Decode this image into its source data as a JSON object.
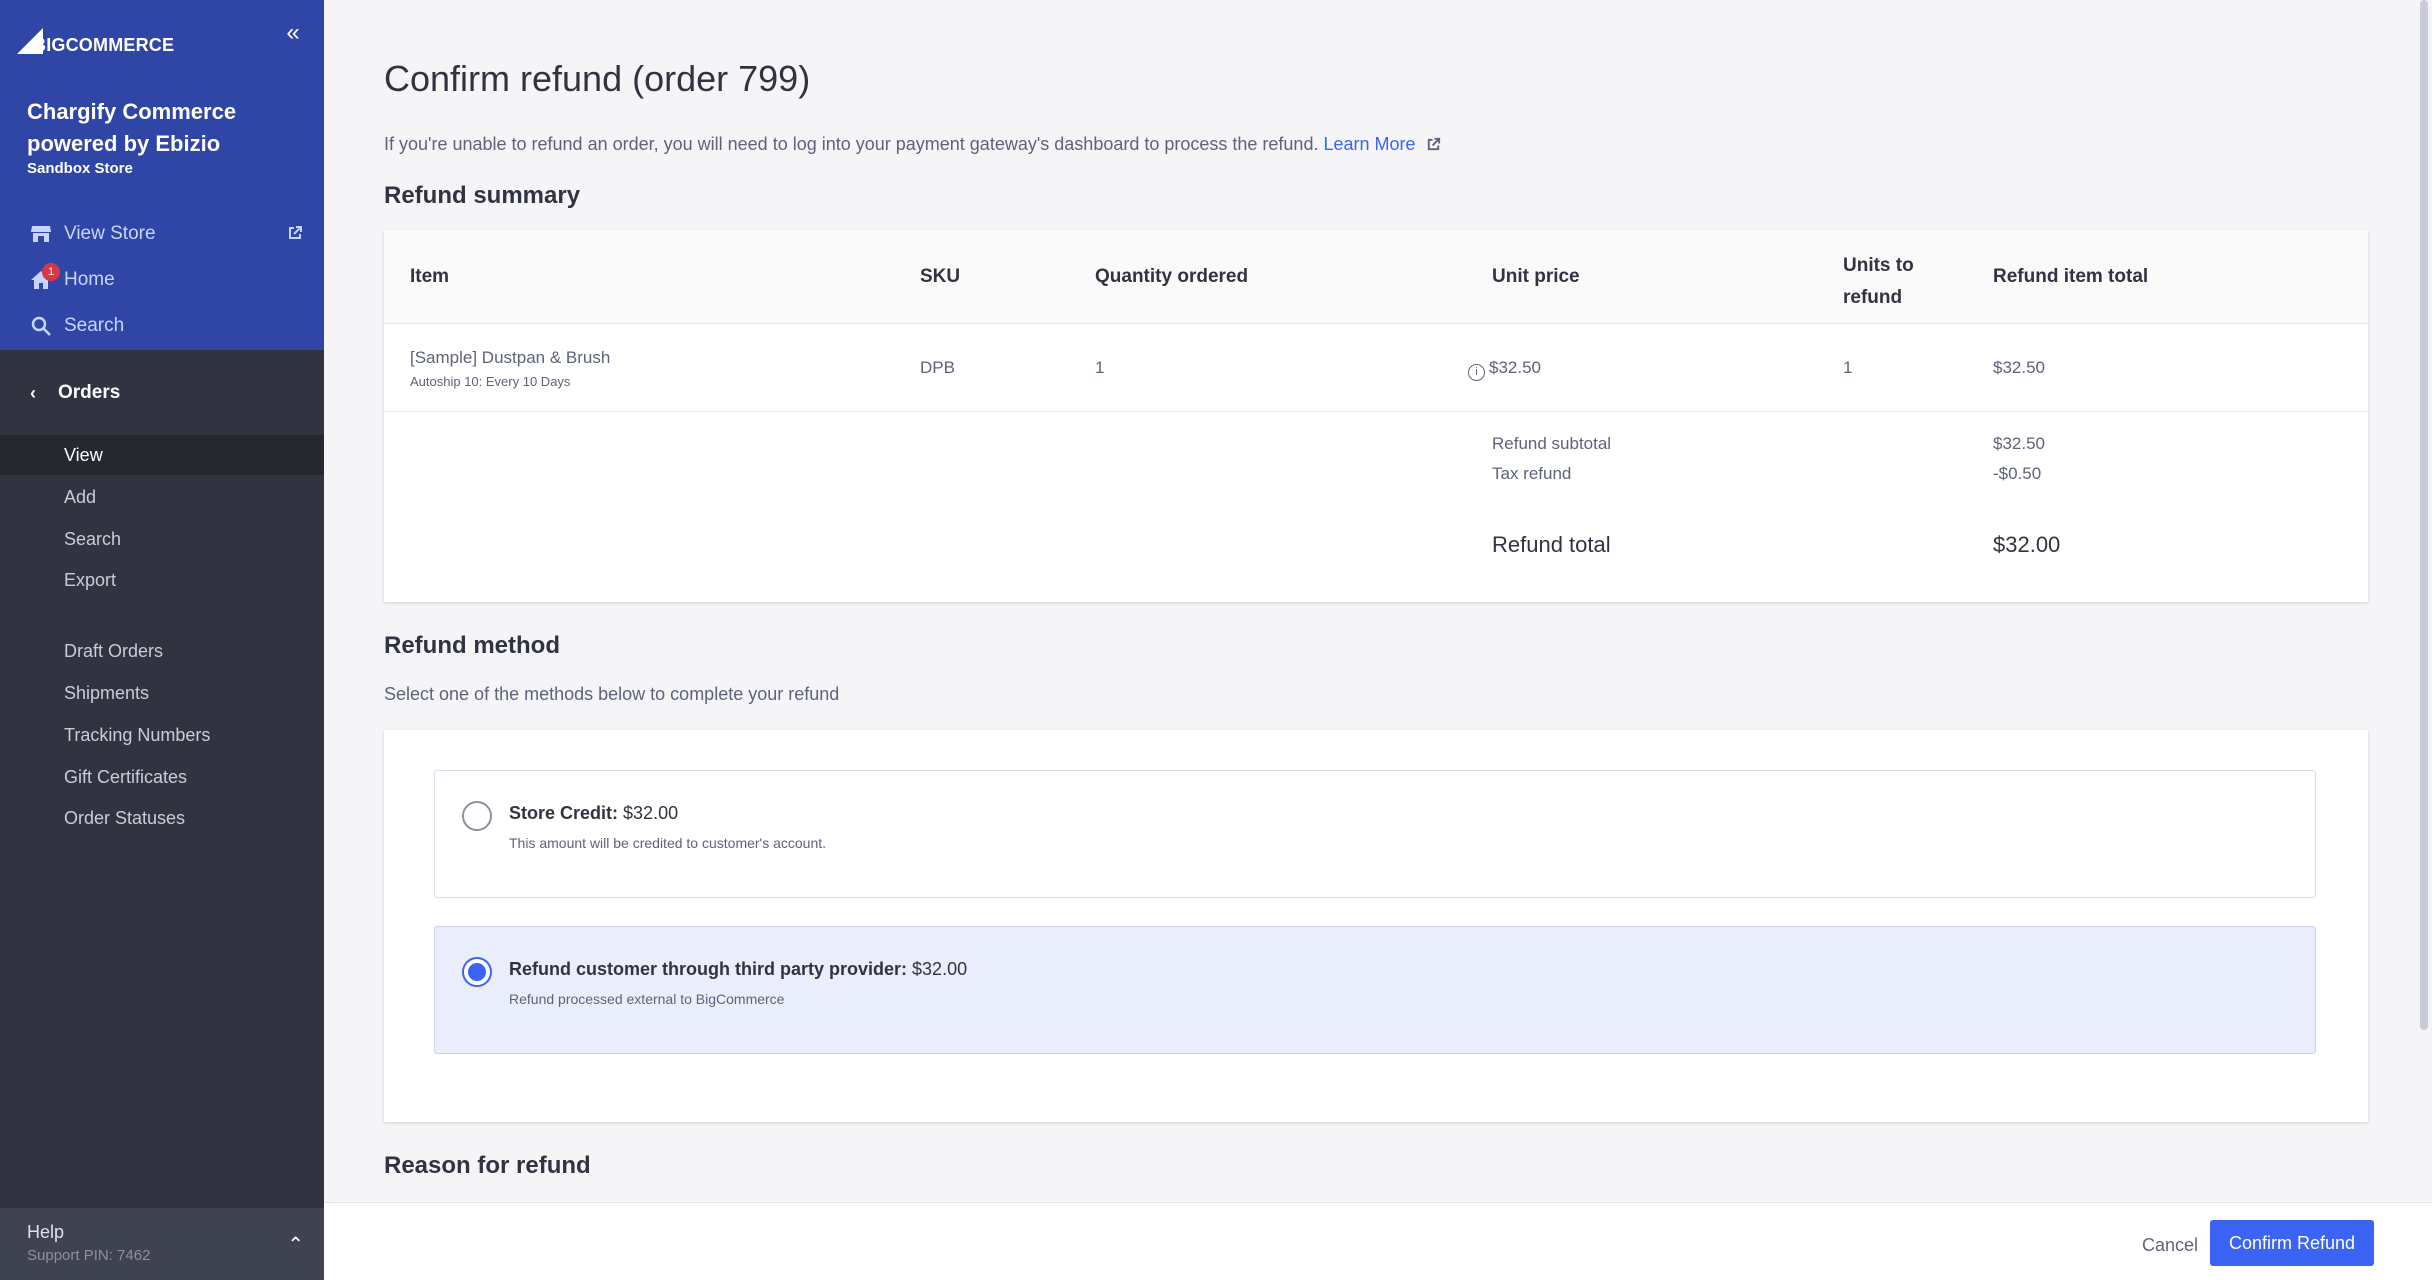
{
  "sidebar": {
    "logo_text": "BIGCOMMERCE",
    "store_name": "Chargify Commerce powered by Ebizio",
    "store_sub": "Sandbox Store",
    "top_links": [
      {
        "label": "View Store",
        "icon": "storefront-icon"
      },
      {
        "label": "Home",
        "icon": "home-icon",
        "badge": "1"
      },
      {
        "label": "Search",
        "icon": "search-icon"
      }
    ],
    "section": "Orders",
    "sub_items": [
      "View",
      "Add",
      "Search",
      "Export",
      "Draft Orders",
      "Shipments",
      "Tracking Numbers",
      "Gift Certificates",
      "Order Statuses"
    ],
    "active_item": "View",
    "help_label": "Help",
    "support_pin": "Support PIN: 7462"
  },
  "page": {
    "title": "Confirm refund (order 799)",
    "intro": "If you're unable to refund an order, you will need to log into your payment gateway's dashboard to process the refund.",
    "learn_more": "Learn More"
  },
  "summary": {
    "heading": "Refund summary",
    "columns": [
      "Item",
      "SKU",
      "Quantity ordered",
      "Unit price",
      "Units to refund",
      "Refund item total"
    ],
    "row": {
      "item": "[Sample] Dustpan & Brush",
      "item_sub": "Autoship 10: Every 10 Days",
      "sku": "DPB",
      "qty": "1",
      "unit_price": "$32.50",
      "units": "1",
      "total": "$32.50"
    },
    "subtotal_label": "Refund subtotal",
    "subtotal_value": "$32.50",
    "tax_label": "Tax refund",
    "tax_value": "-$0.50",
    "total_label": "Refund total",
    "total_value": "$32.00"
  },
  "method": {
    "heading": "Refund method",
    "desc": "Select one of the methods below to complete your refund",
    "options": [
      {
        "label": "Store Credit:",
        "amount": "$32.00",
        "sub": "This amount will be credited to customer's account.",
        "selected": false
      },
      {
        "label": "Refund customer through third party provider:",
        "amount": "$32.00",
        "sub": "Refund processed external to BigCommerce",
        "selected": true
      }
    ]
  },
  "reason": {
    "heading": "Reason for refund"
  },
  "footer": {
    "cancel": "Cancel",
    "confirm": "Confirm Refund"
  },
  "colors": {
    "accent": "#3c64f4",
    "sidebar": "#313440",
    "sidebar_top": "#2f46a7"
  }
}
